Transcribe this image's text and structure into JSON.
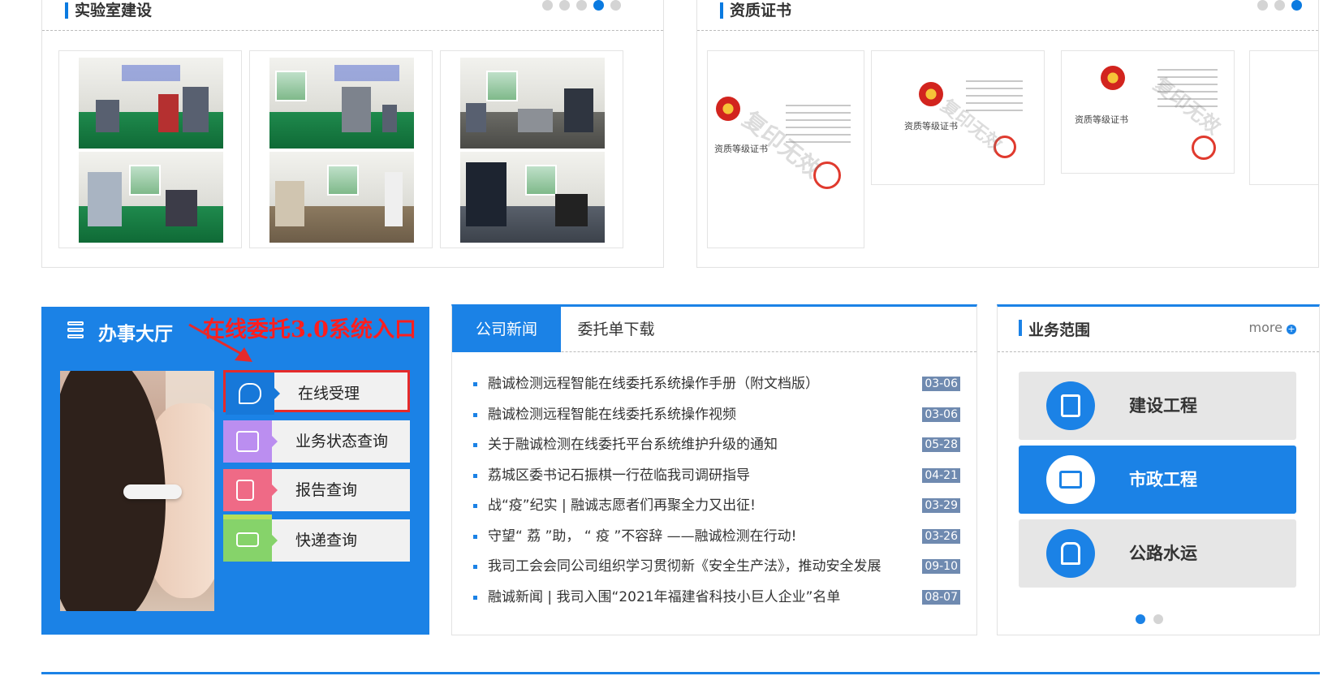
{
  "lab": {
    "title": "实验室建设",
    "carousel_pages": 5,
    "active_page": 4
  },
  "cert": {
    "title": "资质证书",
    "carousel_pages": 3,
    "active_page": 3,
    "cert_title": "资质等级证书",
    "watermark": "复印无效"
  },
  "hall": {
    "title": "办事大厅",
    "promo": "在线委托3.0系统入口",
    "services": [
      {
        "label": "在线受理",
        "icon": "chat-bubbles-icon"
      },
      {
        "label": "业务状态查询",
        "icon": "edit-icon"
      },
      {
        "label": "报告查询",
        "icon": "report-search-icon"
      },
      {
        "label": "快递查询",
        "icon": "delivery-truck-icon"
      }
    ]
  },
  "news": {
    "tabs": [
      "公司新闻",
      "委托单下载"
    ],
    "items": [
      {
        "title": "融诚检测远程智能在线委托系统操作手册（附文档版）",
        "date": "03-06"
      },
      {
        "title": "融诚检测远程智能在线委托系统操作视频",
        "date": "03-06"
      },
      {
        "title": "关于融诚检测在线委托平台系统维护升级的通知",
        "date": "05-28"
      },
      {
        "title": "荔城区委书记石振棋一行莅临我司调研指导",
        "date": "04-21"
      },
      {
        "title": "战“疫”纪实 | 融诚志愿者们再聚全力又出征!",
        "date": "03-29"
      },
      {
        "title": "守望“ 荔 ”助， “ 疫 ”不容辞 ——融诚检测在行动!",
        "date": "03-26"
      },
      {
        "title": "我司工会会同公司组织学习贯彻新《安全生产法》，推动安全发展",
        "date": "09-10"
      },
      {
        "title": "融诚新闻 | 我司入围“2021年福建省科技小巨人企业”名单",
        "date": "08-07"
      }
    ]
  },
  "biz": {
    "title": "业务范围",
    "more": "more",
    "items": [
      {
        "name": "建设工程",
        "icon": "building-icon",
        "active": false
      },
      {
        "name": "市政工程",
        "icon": "municipal-board-icon",
        "active": true
      },
      {
        "name": "公路水运",
        "icon": "road-icon",
        "active": false
      }
    ],
    "carousel_pages": 2,
    "active_page": 1
  },
  "colors": {
    "accent": "#1b82e6",
    "promo": "#ff1e1e",
    "date_badge": "#6f8ab0"
  }
}
